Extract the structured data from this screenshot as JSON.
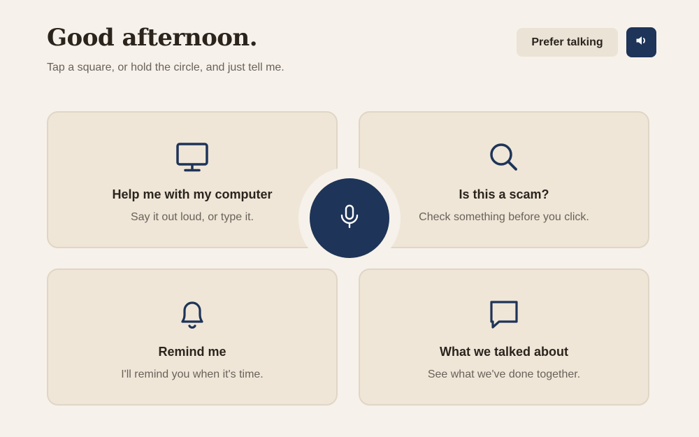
{
  "header": {
    "greeting": "Good afternoon.",
    "subtitle": "Tap a square, or hold the circle, and just tell me.",
    "prefer_talking_label": "Prefer talking",
    "speaker_icon": "speaker-icon"
  },
  "cards": [
    {
      "icon": "monitor-icon",
      "title": "Help me with my computer",
      "description": "Say it out loud, or type it."
    },
    {
      "icon": "search-icon",
      "title": "Is this a scam?",
      "description": "Check something before you click."
    },
    {
      "icon": "bell-icon",
      "title": "Remind me",
      "description": "I'll remind you when it's time."
    },
    {
      "icon": "chat-bubble-icon",
      "title": "What we talked about",
      "description": "See what we've done together."
    }
  ],
  "mic": {
    "icon": "microphone-icon"
  },
  "colors": {
    "background": "#f6f1ea",
    "card": "#efe6d7",
    "accent": "#1e3458",
    "text": "#2a241d",
    "muted_text": "#6a625a"
  }
}
